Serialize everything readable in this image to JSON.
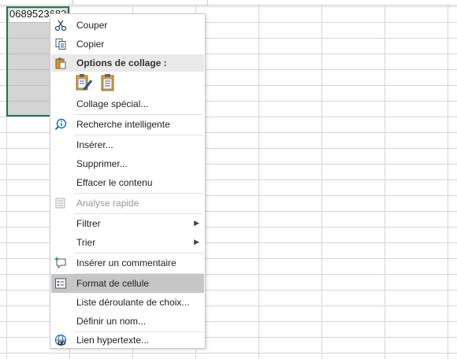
{
  "sheet": {
    "cell_value": "0689523682"
  },
  "menu": {
    "items": [
      {
        "label": "Couper",
        "icon": "scissors-icon"
      },
      {
        "label": "Copier",
        "icon": "copy-icon"
      },
      {
        "label": "Options de collage :",
        "icon": "paste-options-icon"
      },
      {
        "label": "Collage spécial..."
      },
      {
        "label": "Recherche intelligente",
        "icon": "smart-lookup-icon"
      },
      {
        "label": "Insérer..."
      },
      {
        "label": "Supprimer..."
      },
      {
        "label": "Effacer le contenu"
      },
      {
        "label": "Analyse rapide",
        "icon": "quick-analysis-icon",
        "disabled": true
      },
      {
        "label": "Filtrer",
        "submenu": true
      },
      {
        "label": "Trier",
        "submenu": true
      },
      {
        "label": "Insérer un commentaire",
        "icon": "insert-comment-icon"
      },
      {
        "label": "Format de cellule",
        "icon": "format-cells-icon",
        "highlighted": true
      },
      {
        "label": "Liste déroulante de choix..."
      },
      {
        "label": "Définir un nom..."
      },
      {
        "label": "Lien hypertexte...",
        "icon": "hyperlink-icon"
      }
    ],
    "paste_buttons": [
      "paste-formatting-icon",
      "paste-icon"
    ]
  },
  "colors": {
    "selection_border": "#217346",
    "highlight": "#c6c6c6"
  }
}
